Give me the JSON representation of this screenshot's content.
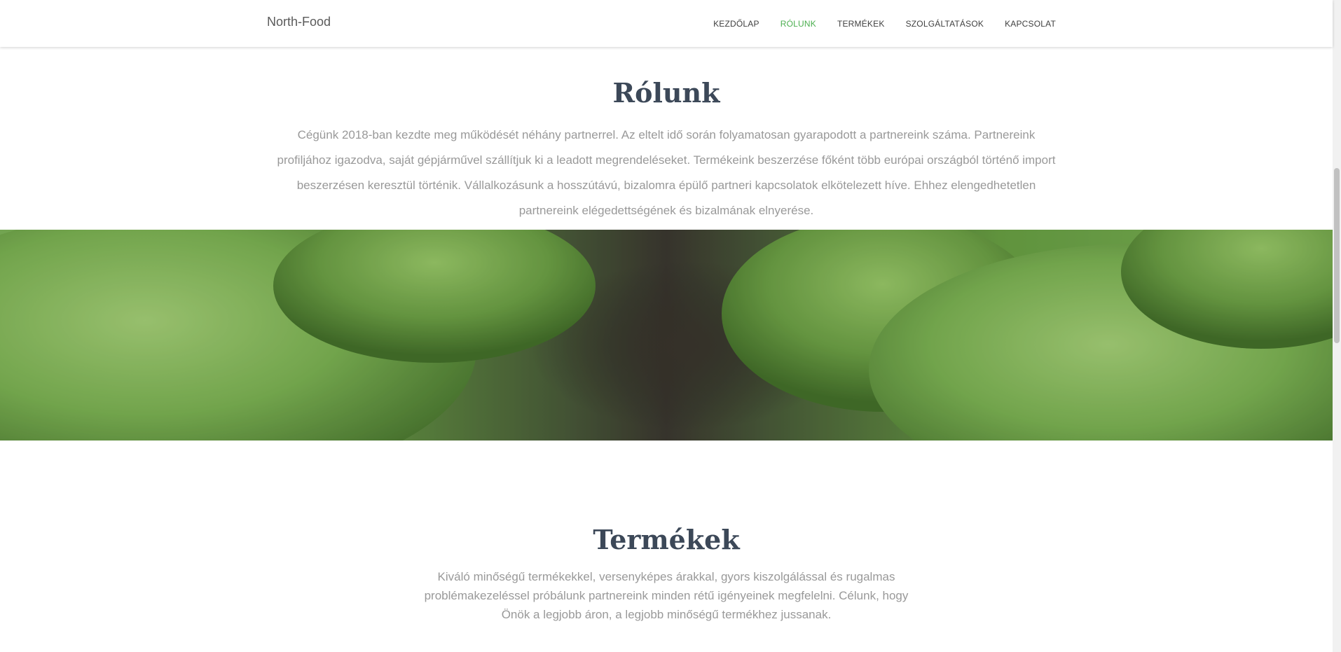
{
  "brand": {
    "name": "North-Food"
  },
  "nav": {
    "items": [
      {
        "label": "KEZDŐLAP"
      },
      {
        "label": "RÓLUNK"
      },
      {
        "label": "TERMÉKEK"
      },
      {
        "label": "SZOLGÁLTATÁSOK"
      },
      {
        "label": "KAPCSOLAT"
      }
    ],
    "active_index": 1,
    "active_color": "#4caf50"
  },
  "about": {
    "title": "Rólunk",
    "text": "Cégünk 2018-ban kezdte meg működését néhány partnerrel. Az eltelt idő során folyamatosan gyarapodott a partnereink száma. Partnereink profiljához igazodva, saját gépjárművel szállítjuk ki a leadott megrendeléseket. Termékeink beszerzése főként több európai országból történő import beszerzésen keresztül történik. Vállalkozásunk a hosszútávú, bizalomra épülő partneri kapcsolatok elkötelezett híve. Ehhez elengedhetetlen partnereink elégedettségének és bizalmának elnyerése."
  },
  "products": {
    "title": "Termékek",
    "text": "Kiváló minőségű termékekkel, versenyképes árakkal, gyors kiszolgálással és rugalmas problémakezeléssel próbálunk partnereink minden rétű igényeinek megfelelni. Célunk, hogy Önök a legjobb áron, a legjobb minőségű termékhez jussanak."
  },
  "colors": {
    "title": "#3c4858",
    "body_text": "#999999",
    "nav_text": "#404040"
  }
}
